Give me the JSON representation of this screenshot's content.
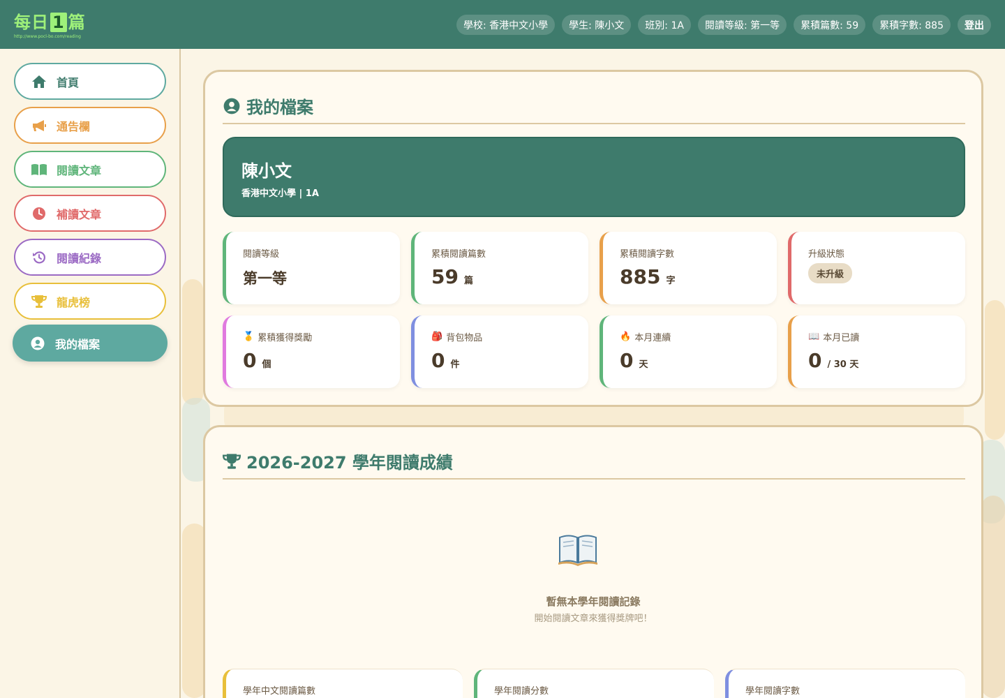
{
  "app": {
    "logo_text_1": "每日",
    "logo_text_box": "1",
    "logo_text_2": "篇",
    "logo_url": "http://www.pocl-bo.com/reading"
  },
  "header": {
    "school": "學校: 香港中文小學",
    "student": "學生: 陳小文",
    "class": "班別: 1A",
    "level": "閱讀等級: 第一等",
    "articles": "累積篇數: 59",
    "words": "累積字數: 885",
    "logout": "登出"
  },
  "sidebar": {
    "items": [
      {
        "label": "首頁",
        "icon": "home-icon",
        "color": "#3e7b6c"
      },
      {
        "label": "通告欄",
        "icon": "megaphone-icon",
        "color": "#e8a04a"
      },
      {
        "label": "閱讀文章",
        "icon": "book-open-icon",
        "color": "#5fb57a"
      },
      {
        "label": "補讀文章",
        "icon": "clock-icon",
        "color": "#e06a6a"
      },
      {
        "label": "閱讀紀錄",
        "icon": "history-icon",
        "color": "#9b6ac4"
      },
      {
        "label": "龍虎榜",
        "icon": "trophy-icon",
        "color": "#e8bf3a"
      },
      {
        "label": "我的檔案",
        "icon": "user-circle-icon",
        "color": "#5ea9a0",
        "active": true
      }
    ]
  },
  "profile": {
    "title": "我的檔案",
    "name": "陳小文",
    "sub": "香港中文小學 | 1A",
    "stats": [
      {
        "label": "閱讀等級",
        "value": "第一等",
        "unit": "",
        "color": "#5fb57a"
      },
      {
        "label": "累積閱讀篇數",
        "value": "59",
        "unit": "篇",
        "color": "#5fb57a"
      },
      {
        "label": "累積閱讀字數",
        "value": "885",
        "unit": "字",
        "color": "#e8a04a"
      },
      {
        "label": "升級狀態",
        "badge": "未升級",
        "color": "#e06a6a"
      },
      {
        "label": "累積獲得獎勵",
        "emoji": "🥇",
        "value": "0",
        "unit": "個",
        "color": "#e07adf"
      },
      {
        "label": "背包物品",
        "emoji": "🎒",
        "value": "0",
        "unit": "件",
        "color": "#7f8fe0"
      },
      {
        "label": "本月連續",
        "emoji": "🔥",
        "value": "0",
        "unit": "天",
        "color": "#5fb57a"
      },
      {
        "label": "本月已讀",
        "emoji": "📖",
        "value": "0",
        "unit": "/ 30 天",
        "color": "#e8a04a"
      }
    ]
  },
  "achievements": {
    "title": "2026-2027 學年閱讀成績",
    "empty_title": "暫無本學年閱讀記錄",
    "empty_sub": "開始閱讀文章來獲得獎牌吧！",
    "mini": [
      {
        "label": "學年中文閱讀篇數",
        "color": "#e8bf3a"
      },
      {
        "label": "學年閱讀分數",
        "color": "#5fb57a"
      },
      {
        "label": "學年閱讀字數",
        "color": "#7f8fe0"
      }
    ]
  }
}
